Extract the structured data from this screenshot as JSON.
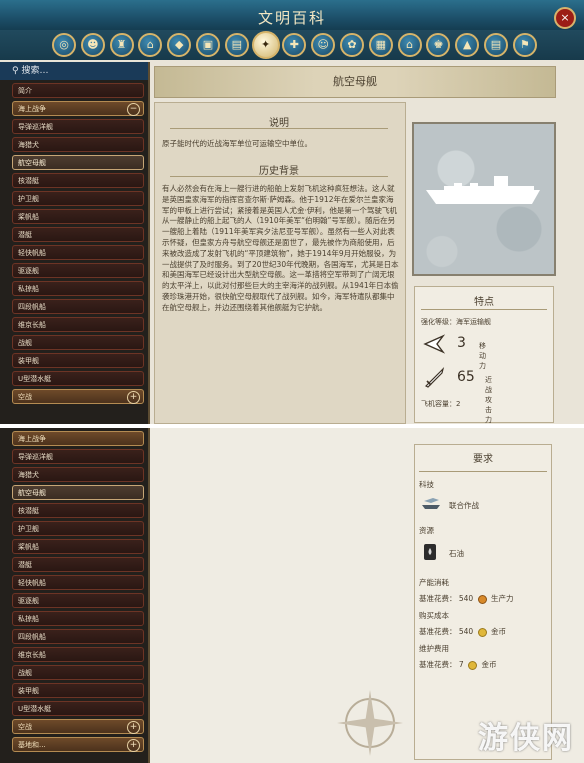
{
  "window": {
    "title": "文明百科",
    "close_label": "×"
  },
  "categories": [
    {
      "icon": "globe-icon"
    },
    {
      "icon": "people-icon"
    },
    {
      "icon": "trophy-icon"
    },
    {
      "icon": "building-icon"
    },
    {
      "icon": "box-icon"
    },
    {
      "icon": "city-icon"
    },
    {
      "icon": "district-icon"
    },
    {
      "icon": "unit-icon",
      "active": true
    },
    {
      "icon": "promotion-icon"
    },
    {
      "icon": "leader-icon"
    },
    {
      "icon": "resource-icon"
    },
    {
      "icon": "book-icon"
    },
    {
      "icon": "temple-icon"
    },
    {
      "icon": "governor-icon"
    },
    {
      "icon": "terrain-icon"
    },
    {
      "icon": "scroll-icon"
    },
    {
      "icon": "flag-icon"
    }
  ],
  "sidebar": {
    "search_placeholder": "搜索…",
    "top_items": [
      {
        "label": "简介"
      },
      {
        "label": "海上战争",
        "header": true,
        "toggle": "−"
      },
      {
        "label": "导弹巡洋舰"
      },
      {
        "label": "海猎犬"
      },
      {
        "label": "航空母舰",
        "selected": true
      },
      {
        "label": "核潜艇"
      },
      {
        "label": "护卫舰"
      },
      {
        "label": "桨帆船"
      },
      {
        "label": "潜艇"
      },
      {
        "label": "轻快帆船"
      },
      {
        "label": "驱逐舰"
      },
      {
        "label": "私掠船"
      },
      {
        "label": "四段帆船"
      },
      {
        "label": "维京长船"
      },
      {
        "label": "战舰"
      },
      {
        "label": "装甲舰"
      },
      {
        "label": "U型潜水艇"
      },
      {
        "label": "空战",
        "header": true,
        "toggle": "+"
      }
    ],
    "bottom_items": [
      {
        "label": "海上战争",
        "header": true
      },
      {
        "label": "导弹巡洋舰"
      },
      {
        "label": "海猎犬"
      },
      {
        "label": "航空母舰",
        "selected": true
      },
      {
        "label": "核潜艇"
      },
      {
        "label": "护卫舰"
      },
      {
        "label": "桨帆船"
      },
      {
        "label": "潜艇"
      },
      {
        "label": "轻快帆船"
      },
      {
        "label": "驱逐舰"
      },
      {
        "label": "私掠船"
      },
      {
        "label": "四段帆船"
      },
      {
        "label": "维京长船"
      },
      {
        "label": "战舰"
      },
      {
        "label": "装甲舰"
      },
      {
        "label": "U型潜水艇"
      },
      {
        "label": "空战",
        "header": true,
        "toggle": "+"
      },
      {
        "label": "基地和...",
        "header": true,
        "toggle": "+"
      }
    ]
  },
  "article": {
    "title": "航空母舰",
    "description_heading": "说明",
    "description": "原子能时代的近战海军单位可运输空中单位。",
    "history_heading": "历史背景",
    "history": "有人必然会有在海上一艘行进的船舶上发射飞机这种疯狂想法。这人就是英国皇家海军的指挥官查尔斯·萨姆森。他于1912年在爱尔兰皇家海军的甲板上进行尝试；紧接着是英国人尤金·伊利，他是第一个驾驶飞机从一艘静止的船上起飞的人（1910年美军“伯明翰”号军舰）。随后在另一艘船上着陆（1911年美军宾夕法尼亚号军舰）。虽然有一些人对此表示怀疑，但皇家方舟号航空母舰还是面世了，最先被作为商船使用，后来被改造成了发射飞机的“平顶建筑物”，她于1914年9月开始服役，为一战提供了及时服务。到了20世纪30年代晚期，各国海军，尤其是日本和美国海军已经设计出大型航空母舰。这一革措将空军带到了广阔无垠的太平洋上，以此对付那些巨大的主宰海洋的战列舰。从1941年日本偷袭珍珠港开始，很快航空母舰取代了战列舰。如今，海军特遣队都集中在航空母舰上，并边还围绕着其他舰艇为它护航。"
  },
  "traits": {
    "heading": "特点",
    "promotion_class": "强化等级：海军运输舰",
    "movement": {
      "value": "3",
      "label": "移动力",
      "icon": "movement-arrow-icon"
    },
    "melee": {
      "value": "65",
      "label": "近战攻击力",
      "icon": "sword-icon"
    },
    "aircraft_capacity": "飞机容量：2"
  },
  "requirements": {
    "heading": "要求",
    "tech_heading": "科技",
    "tech": "联合作战",
    "resource_heading": "资源",
    "resource": "石油",
    "production_heading": "产能消耗",
    "production_base": "基准花费：",
    "production_value": "540",
    "production_unit": "生产力",
    "purchase_heading": "购买成本",
    "purchase_base": "基准花费：",
    "purchase_value": "540",
    "purchase_unit": "金币",
    "maintenance_heading": "维护费用",
    "maintenance_base": "基准花费：",
    "maintenance_value": "7",
    "maintenance_unit": "金币"
  },
  "watermark": "游侠网"
}
